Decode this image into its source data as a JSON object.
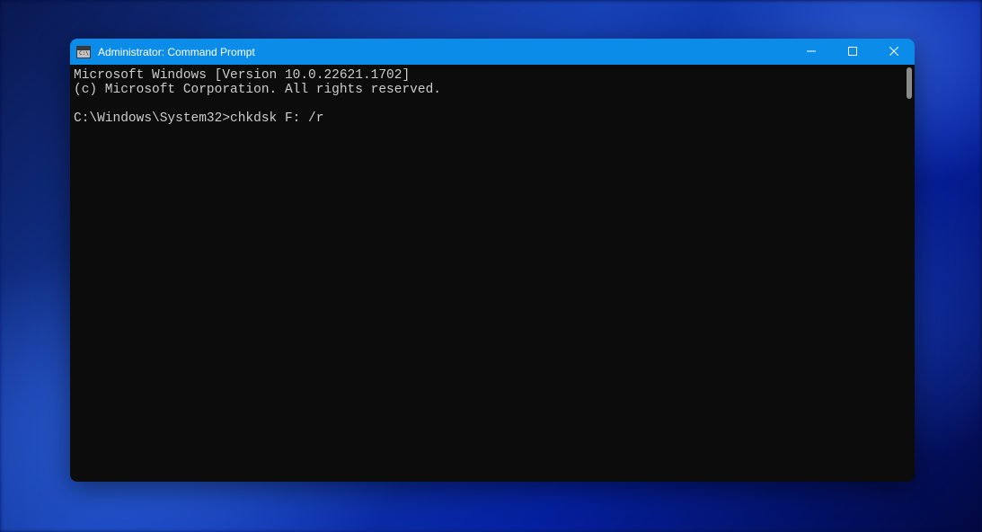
{
  "window": {
    "title": "Administrator: Command Prompt"
  },
  "terminal": {
    "line1": "Microsoft Windows [Version 10.0.22621.1702]",
    "line2": "(c) Microsoft Corporation. All rights reserved.",
    "prompt": "C:\\Windows\\System32>",
    "command": "chkdsk F: /r"
  }
}
